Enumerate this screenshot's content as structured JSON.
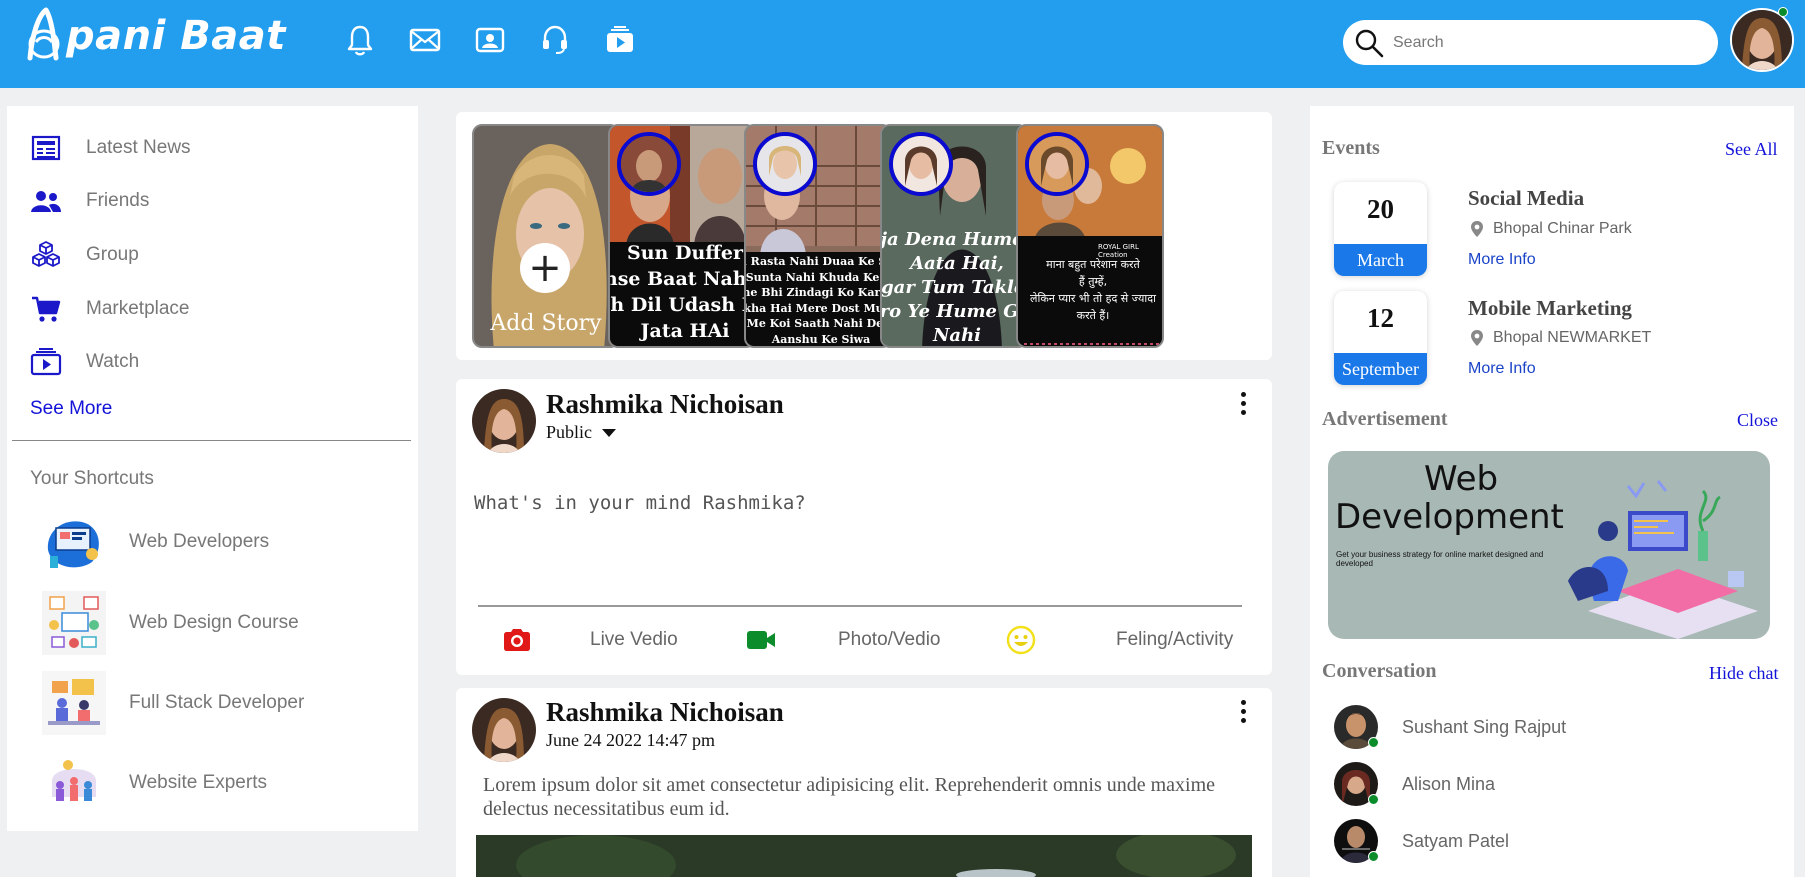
{
  "app": {
    "logo_text": "pani Baat"
  },
  "header": {
    "nav_icons": [
      "bell-icon",
      "mail-icon",
      "contact-card-icon",
      "headset-icon",
      "video-play-icon"
    ],
    "search": {
      "placeholder": "Search",
      "value": ""
    },
    "brand_color": "#239ded"
  },
  "sidebar": {
    "items": [
      {
        "label": "Latest News",
        "icon": "newspaper-icon"
      },
      {
        "label": "Friends",
        "icon": "friends-icon"
      },
      {
        "label": "Group",
        "icon": "cubes-icon"
      },
      {
        "label": "Marketplace",
        "icon": "cart-icon"
      },
      {
        "label": "Watch",
        "icon": "watch-video-icon"
      }
    ],
    "see_more": "See More",
    "shortcuts_title": "Your Shortcuts",
    "shortcuts": [
      {
        "label": "Web Developers"
      },
      {
        "label": "Web Design Course"
      },
      {
        "label": "Full Stack Developer"
      },
      {
        "label": "Website Experts"
      }
    ]
  },
  "stories": {
    "add_label": "Add Story",
    "items": [
      {
        "caption_lines": [
          "Sun Duffer",
          "anse Baat Nahi H",
          "oh Dil Udash Ho",
          "Jata HAi"
        ]
      },
      {
        "caption_lines": [
          "bi Rasta Nahi Duaa Ke Siwa",
          "bi Sunta Nahi Khuda Ke Siwa",
          "aine Bhi Zindagi Ko Karib Se",
          "ekha Hai Mere Dost Mushk",
          "Me Koi Saath Nahi Deta",
          "Aanshu Ke Siwa"
        ]
      },
      {
        "caption_lines": [
          "aja Dena Hume B",
          "Aata Hai,",
          "agar Tum Takleef",
          "ero Ye Hume Gaw",
          "Nahi"
        ]
      },
      {
        "caption_lines": [
          "माना बहुत परेशान करते",
          "हैं तुम्हें,",
          "लेकिन प्यार भी तो हद से ज्यादा",
          "करते हैं।"
        ],
        "watermark": "ROYAL GIRL Creation"
      }
    ]
  },
  "composer": {
    "user_name": "Rashmika Nichoisan",
    "privacy": "Public",
    "placeholder": "What's in your mind Rashmika?",
    "actions": [
      {
        "label": "Live Vedio",
        "icon": "camera-icon"
      },
      {
        "label": "Photo/Vedio",
        "icon": "video-camera-icon"
      },
      {
        "label": "Feling/Activity",
        "icon": "smiley-icon"
      }
    ]
  },
  "post": {
    "user_name": "Rashmika Nichoisan",
    "date": "June 24 2022 14:47 pm",
    "text": "Lorem ipsum dolor sit amet consectetur adipisicing elit. Reprehenderit omnis unde maxime delectus necessitatibus eum id."
  },
  "events": {
    "title": "Events",
    "see_all": "See All",
    "items": [
      {
        "day": "20",
        "month": "March",
        "title": "Social Media",
        "place": "Bhopal Chinar Park",
        "more": "More Info"
      },
      {
        "day": "12",
        "month": "September",
        "title": "Mobile Marketing",
        "place": "Bhopal NEWMARKET",
        "more": "More Info"
      }
    ]
  },
  "advertisement": {
    "title": "Advertisement",
    "close": "Close",
    "ad_line1": "Web",
    "ad_line2": "Development",
    "ad_text": "Get your business strategy for online market designed and developed"
  },
  "conversation": {
    "title": "Conversation",
    "hide": "Hide chat",
    "contacts": [
      {
        "name": "Sushant Sing Rajput",
        "online": true
      },
      {
        "name": "Alison Mina",
        "online": true
      },
      {
        "name": "Satyam Patel",
        "online": true
      }
    ]
  },
  "colors": {
    "link": "#1212d8",
    "accent_blue": "#1b78e8",
    "online": "#0a8c2a",
    "story_ring": "#0a0ad0"
  }
}
